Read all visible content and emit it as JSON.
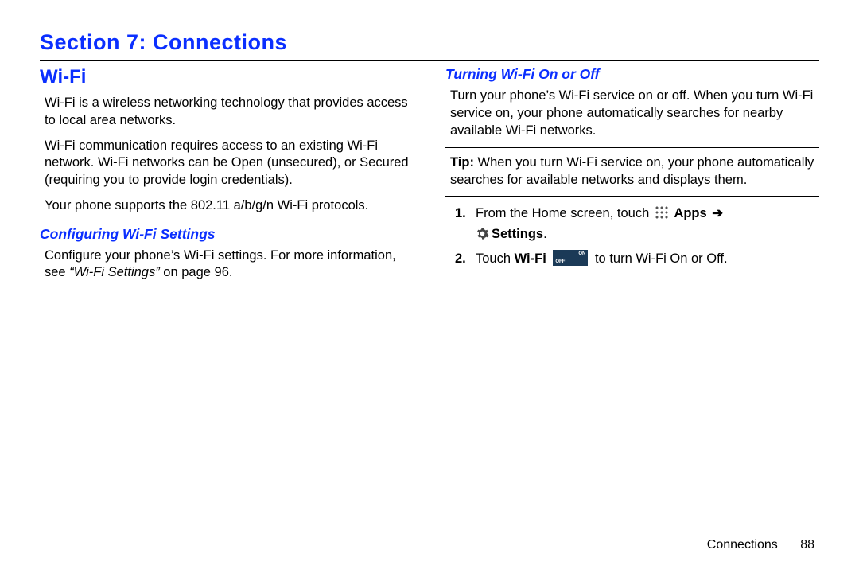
{
  "section_title": "Section 7: Connections",
  "left": {
    "h2": "Wi-Fi",
    "p1": "Wi-Fi is a wireless networking technology that provides access to local area networks.",
    "p2": "Wi-Fi communication requires access to an existing Wi-Fi network. Wi-Fi networks can be Open (unsecured), or Secured (requiring you to provide login credentials).",
    "p3": "Your phone supports the 802.11 a/b/g/n Wi-Fi protocols.",
    "sub1": "Configuring Wi-Fi Settings",
    "p4a": "Configure your phone’s Wi-Fi settings. For more information, see ",
    "p4_xref": "“Wi-Fi Settings”",
    "p4b": " on page 96."
  },
  "right": {
    "sub1": "Turning Wi-Fi On or Off",
    "p1": "Turn your phone’s Wi-Fi service on or off. When you turn Wi-Fi service on, your phone automatically searches for nearby available Wi-Fi networks.",
    "tip_label": "Tip:",
    "tip_text": " When you turn Wi-Fi service on, your phone automatically searches for available networks and displays them.",
    "step1_num": "1.",
    "step1_a": "From the Home screen, touch ",
    "step1_apps": "Apps",
    "step1_arrow": "➔",
    "step1_settings": "Settings",
    "step1_period": ".",
    "step2_num": "2.",
    "step2_a": "Touch ",
    "step2_wifi": "Wi-Fi",
    "toggle_on": "ON",
    "toggle_off": "OFF",
    "step2_b": " to turn Wi-Fi On or Off."
  },
  "footer": {
    "chapter": "Connections",
    "page": "88"
  }
}
